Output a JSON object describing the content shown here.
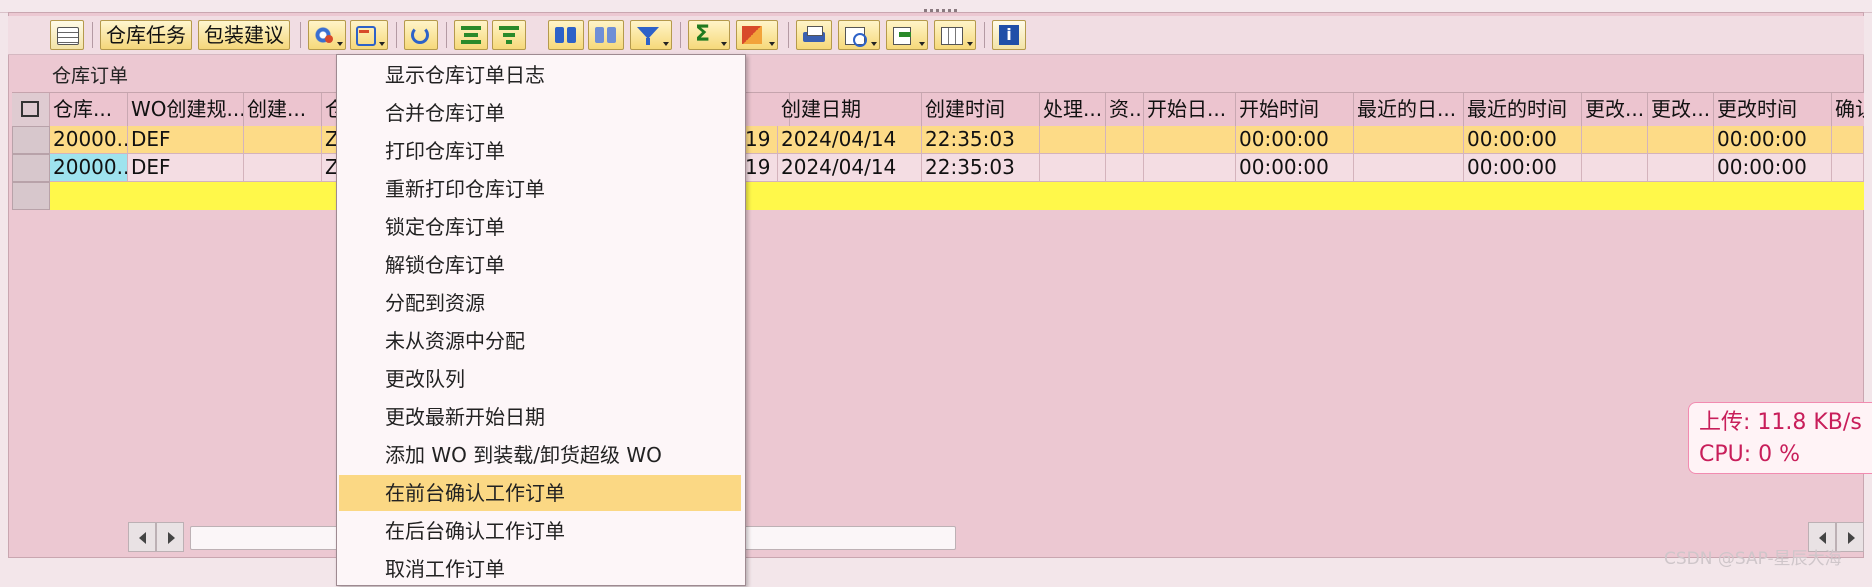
{
  "toolbar": {
    "buttons": {
      "warehouse_task": "仓库任务",
      "packing_proposal": "包装建议"
    },
    "icons": {
      "layout": "layout-icon",
      "settings": "gear-icon",
      "undo": "undo-icon",
      "refresh": "refresh-icon",
      "align_top": "align-top-icon",
      "align_bottom": "align-bottom-icon",
      "find": "binoculars-icon",
      "find_next": "binoculars-next-icon",
      "filter": "filter-icon",
      "sum": "sum-icon",
      "subtotal": "subtotal-icon",
      "print": "print-icon",
      "print_preview": "print-preview-icon",
      "export": "export-icon",
      "columns": "column-layout-icon",
      "info": "info-icon"
    }
  },
  "grid": {
    "title": "仓库订单",
    "columns": [
      "仓库...",
      "WO创建规...",
      "创建...",
      "仓",
      "",
      "创建日期",
      "创建时间",
      "处理...",
      "资...",
      "开始日...",
      "开始时间",
      "最近的日...",
      "最近的时间",
      "更改...",
      "更改...",
      "更改时间",
      "确认"
    ],
    "rows": [
      [
        "20000...",
        "DEF",
        "",
        "Z",
        "19",
        "2024/04/14",
        "22:35:03",
        "",
        "",
        "",
        "00:00:00",
        "",
        "00:00:00",
        "",
        "",
        "00:00:00",
        ""
      ],
      [
        "20000...",
        "DEF",
        "",
        "Z",
        "19",
        "2024/04/14",
        "22:35:03",
        "",
        "",
        "",
        "00:00:00",
        "",
        "00:00:00",
        "",
        "",
        "00:00:00",
        ""
      ]
    ]
  },
  "context_menu": {
    "items": [
      "显示仓库订单日志",
      "合并仓库订单",
      "打印仓库订单",
      "重新打印仓库订单",
      "锁定仓库订单",
      "解锁仓库订单",
      "分配到资源",
      "未从资源中分配",
      "更改队列",
      "更改最新开始日期",
      "添加 WO 到装载/卸货超级 WO",
      "在前台确认工作订单",
      "在后台确认工作订单",
      "取消工作订单"
    ],
    "highlighted": "在前台确认工作订单"
  },
  "net_monitor": {
    "upload": "上传: 11.8 KB/s",
    "cpu": "CPU: 0 %"
  },
  "watermark": "CSDN @SAP-星辰大海",
  "colors": {
    "background": "#ecc8d2",
    "row_selected": "#fddb87",
    "row_normal": "#f4dde3",
    "new_row": "#fff84a",
    "cell_focus": "#9ee3ee",
    "menu_highlight": "#fbd884"
  }
}
